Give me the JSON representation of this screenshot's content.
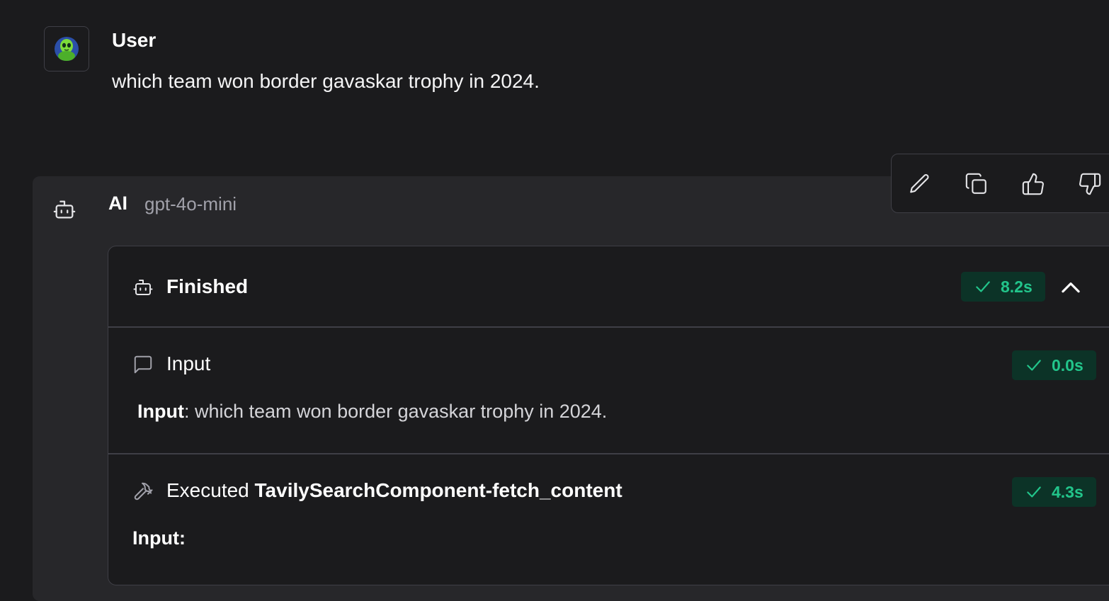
{
  "user_message": {
    "author": "User",
    "text": "which team won border gavaskar trophy in 2024."
  },
  "ai_message": {
    "author": "AI",
    "model": "gpt-4o-mini"
  },
  "actions": {
    "icons": [
      "pencil-icon",
      "copy-icon",
      "thumbs-up-icon",
      "thumbs-down-icon"
    ]
  },
  "steps": {
    "status": "Finished",
    "total_duration": "8.2s",
    "items": [
      {
        "title": "Input",
        "duration": "0.0s",
        "body_label": "Input",
        "body_text": ": which team won border gavaskar trophy in 2024."
      },
      {
        "title_prefix": "Executed ",
        "title_tool": "TavilySearchComponent-fetch_content",
        "duration": "4.3s",
        "body_label": "Input:"
      }
    ]
  },
  "colors": {
    "background": "#1b1b1d",
    "panel": "#27272a",
    "border": "#3f3f46",
    "success_text": "#22c58b",
    "success_bg": "#0c3327"
  }
}
